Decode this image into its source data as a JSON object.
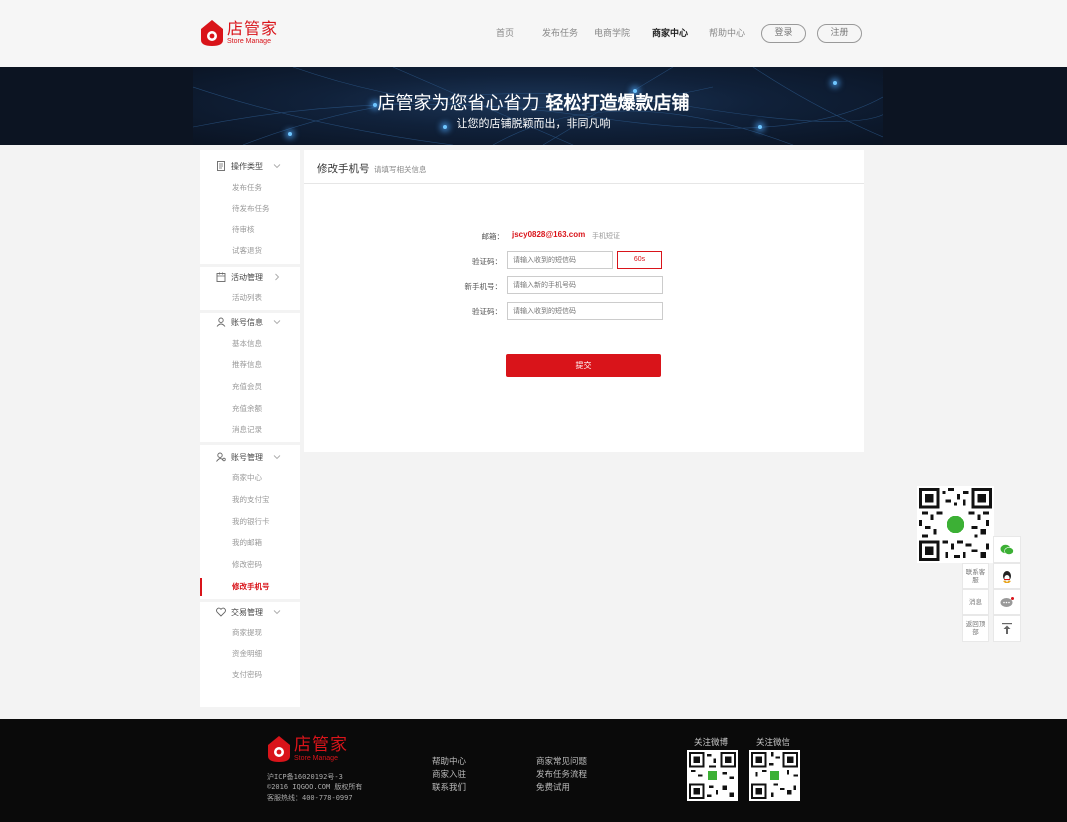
{
  "brand": {
    "cn": "店管家",
    "en": "Store Manage",
    "color": "#d9141a"
  },
  "nav": {
    "items": [
      "首页",
      "发布任务",
      "电商学院",
      "商家中心",
      "帮助中心"
    ],
    "active": "商家中心",
    "login": "登录",
    "register": "注册"
  },
  "banner": {
    "title_main": "店管家为您省心省力",
    "title_bold": "轻松打造爆款店铺",
    "subtitle": "让您的店铺脱颖而出，非同凡响"
  },
  "sidebar": {
    "groups": [
      {
        "title": "操作类型",
        "icon": "document-icon",
        "items": [
          "发布任务",
          "待发布任务",
          "待审核",
          "试客退货"
        ]
      },
      {
        "title": "活动管理",
        "icon": "calendar-icon",
        "items": [
          "活动列表"
        ]
      },
      {
        "title": "账号信息",
        "icon": "user-icon",
        "items": [
          "基本信息",
          "推荐信息",
          "充值会员",
          "充值余额",
          "消息记录"
        ]
      },
      {
        "title": "账号管理",
        "icon": "user-settings-icon",
        "items": [
          "商家中心",
          "我的支付宝",
          "我的银行卡",
          "我的邮箱",
          "修改密码",
          "修改手机号"
        ]
      },
      {
        "title": "交易管理",
        "icon": "heart-icon",
        "items": [
          "商家提现",
          "资金明细",
          "支付密码"
        ]
      }
    ],
    "active_item": "修改手机号"
  },
  "panel": {
    "title": "修改手机号",
    "hint": "请填写相关信息",
    "email_label": "邮箱：",
    "email_value": "jscy0828@163.com",
    "email_tag": "手机短证",
    "code1_label": "验证码：",
    "code1_placeholder": "请输入收到的短信码",
    "code_button": "60s",
    "phone_label": "新手机号：",
    "phone_placeholder": "请输入新的手机号码",
    "code2_label": "验证码：",
    "code2_placeholder": "请输入收到的短信码",
    "submit": "提交"
  },
  "float_bar": {
    "contact": "联系客服",
    "message": "消息",
    "back_top": "返回顶部"
  },
  "footer": {
    "icp": "沪ICP备16020192号-3",
    "copyright": "©2016 IQGOO.COM 版权所有",
    "hotline": "客服热线：400-778-0997",
    "links_col1": [
      "帮助中心",
      "商家入驻",
      "联系我们"
    ],
    "links_col2": [
      "商家常见问题",
      "发布任务流程",
      "免费试用"
    ],
    "qr_weibo": "关注微博",
    "qr_wechat": "关注微信"
  }
}
